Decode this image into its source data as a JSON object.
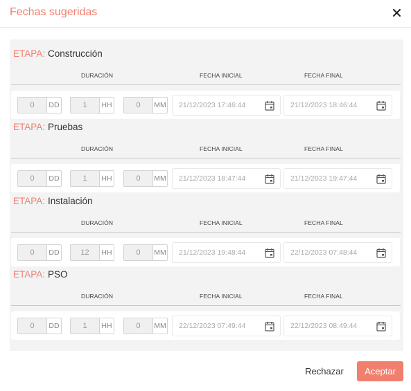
{
  "dialog": {
    "title": "Fechas sugeridas",
    "close_icon": "close-icon"
  },
  "columns": {
    "duration": "DURACIÓN",
    "start_date": "FECHA INICIAL",
    "end_date": "FECHA FINAL"
  },
  "units": {
    "days": "DD",
    "hours": "HH",
    "minutes": "MM"
  },
  "stage_prefix": "ETAPA:",
  "stages": [
    {
      "name": "Construcción",
      "days": "0",
      "hours": "1",
      "minutes": "0",
      "start": "21/12/2023 17:46:44",
      "end": "21/12/2023 18:46:44"
    },
    {
      "name": "Pruebas",
      "days": "0",
      "hours": "1",
      "minutes": "0",
      "start": "21/12/2023 18:47:44",
      "end": "21/12/2023 19:47:44"
    },
    {
      "name": "Instalación",
      "days": "0",
      "hours": "12",
      "minutes": "0",
      "start": "21/12/2023 19:48:44",
      "end": "22/12/2023 07:48:44"
    },
    {
      "name": "PSO",
      "days": "0",
      "hours": "1",
      "minutes": "0",
      "start": "22/12/2023 07:49:44",
      "end": "22/12/2023 08:49:44"
    }
  ],
  "actions": {
    "reject": "Rechazar",
    "accept": "Aceptar"
  },
  "colors": {
    "accent": "#f07f6e",
    "panel": "#f3f3f3"
  }
}
